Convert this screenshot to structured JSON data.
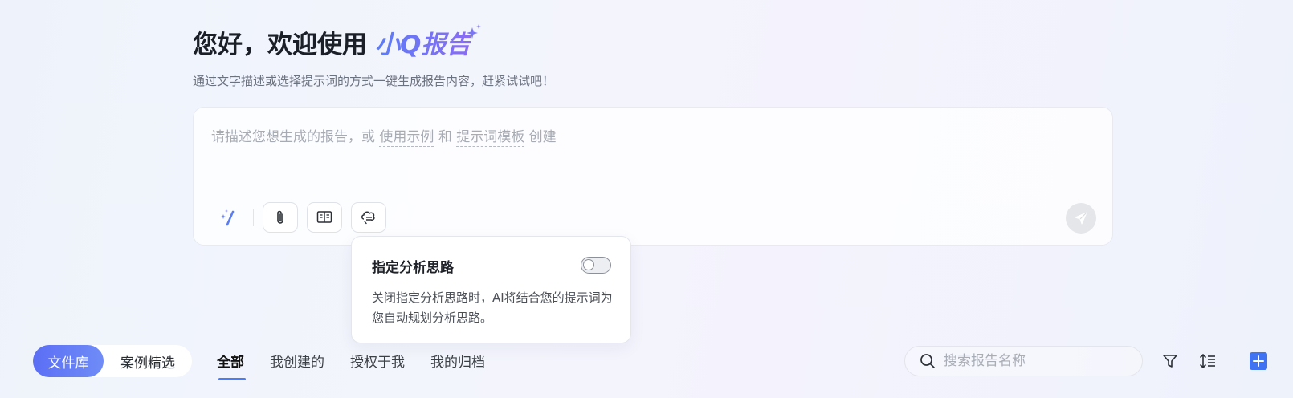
{
  "hero": {
    "greeting": "您好，欢迎使用",
    "brand": "小Q报告",
    "subtitle": "通过文字描述或选择提示词的方式一键生成报告内容，赶紧试试吧！"
  },
  "prompt": {
    "placeholder_pre": "请描述您想生成的报告，或",
    "link_examples": "使用示例",
    "and_text": "和",
    "link_templates": "提示词模板",
    "placeholder_post": "创建"
  },
  "tools": {
    "magic_icon": "magic-wand-icon",
    "attach_icon": "paperclip-icon",
    "knowledge_icon": "book-icon",
    "analysis_icon": "thinking-bubble-icon",
    "send_icon": "send-icon"
  },
  "popover": {
    "title": "指定分析思路",
    "toggle_on": false,
    "description": "关闭指定分析思路时，AI将结合您的提示词为您自动规划分析思路。"
  },
  "library": {
    "active": "文件库",
    "inactive": "案例精选"
  },
  "tabs": [
    {
      "label": "全部",
      "active": true
    },
    {
      "label": "我创建的",
      "active": false
    },
    {
      "label": "授权于我",
      "active": false
    },
    {
      "label": "我的归档",
      "active": false
    }
  ],
  "search": {
    "placeholder": "搜索报告名称",
    "value": ""
  },
  "colors": {
    "accent": "#3f73f1",
    "brand_gradient_start": "#5b7cf6",
    "brand_gradient_end": "#8b6cf2"
  }
}
